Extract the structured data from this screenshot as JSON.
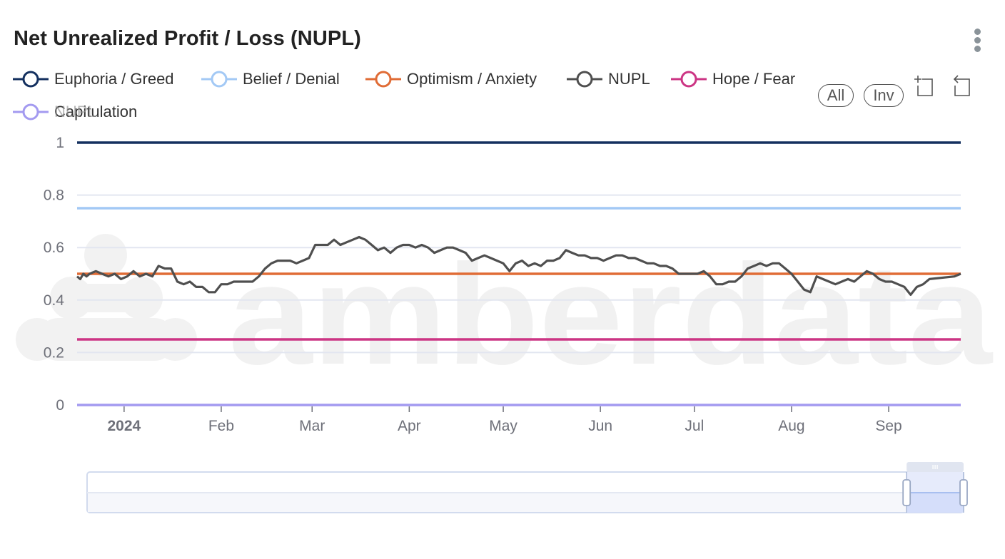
{
  "header": {
    "title": "Net Unrealized Profit / Loss (NUPL)",
    "menu_icon": "kebab-menu-icon"
  },
  "toolbar": {
    "all_label": "All",
    "inv_label": "Inv",
    "zoom_icon": "data-zoom-icon",
    "reset_icon": "zoom-reset-icon"
  },
  "watermark": "amberdata",
  "colors": {
    "euphoria": "#14305f",
    "belief": "#a3c9f5",
    "optimism": "#e06c36",
    "nupl": "#4f4f4f",
    "hope": "#cc3584",
    "capitulation": "#a39af0",
    "grid": "#e2e6f0",
    "axis_text": "#6e7079"
  },
  "legend": [
    {
      "label": "Euphoria / Greed",
      "color": "#14305f"
    },
    {
      "label": "Belief / Denial",
      "color": "#a3c9f5"
    },
    {
      "label": "Optimism / Anxiety",
      "color": "#e06c36"
    },
    {
      "label": "NUPL",
      "color": "#4f4f4f"
    },
    {
      "label": "Hope / Fear",
      "color": "#cc3584"
    },
    {
      "label": "Capitulation",
      "color": "#a39af0",
      "overlap_text": "NUPL"
    }
  ],
  "datazoom": {
    "start_fraction": 0.935,
    "end_fraction": 1.0,
    "handle_icon": "drag-handle-icon"
  },
  "chart_data": {
    "type": "line",
    "title": "Net Unrealized Profit / Loss (NUPL)",
    "xlabel": "",
    "ylabel": "",
    "ylim": [
      0,
      1
    ],
    "xlim": [
      "2023-12-17",
      "2024-09-24"
    ],
    "grid": true,
    "legend_position": "top-left",
    "y_ticks": [
      "0",
      "0.2",
      "0.4",
      "0.6",
      "0.8",
      "1"
    ],
    "x_ticks": [
      {
        "label": "2024",
        "date": "2024-01-01",
        "bold": true
      },
      {
        "label": "Feb",
        "date": "2024-02-01"
      },
      {
        "label": "Mar",
        "date": "2024-03-01"
      },
      {
        "label": "Apr",
        "date": "2024-04-01"
      },
      {
        "label": "May",
        "date": "2024-05-01"
      },
      {
        "label": "Jun",
        "date": "2024-06-01"
      },
      {
        "label": "Jul",
        "date": "2024-07-01"
      },
      {
        "label": "Aug",
        "date": "2024-08-01"
      },
      {
        "label": "Sep",
        "date": "2024-09-01"
      }
    ],
    "thresholds": [
      {
        "name": "Euphoria / Greed",
        "value": 1.0
      },
      {
        "name": "Belief / Denial",
        "value": 0.75
      },
      {
        "name": "Optimism / Anxiety",
        "value": 0.5
      },
      {
        "name": "Hope / Fear",
        "value": 0.25
      },
      {
        "name": "Capitulation",
        "value": 0.0
      }
    ],
    "series": [
      {
        "name": "NUPL",
        "x_days_from_start": [
          0,
          1,
          2,
          3,
          4,
          6,
          8,
          10,
          12,
          14,
          16,
          18,
          20,
          22,
          24,
          26,
          28,
          30,
          32,
          34,
          36,
          38,
          40,
          42,
          44,
          46,
          48,
          50,
          52,
          54,
          56,
          58,
          60,
          62,
          64,
          66,
          68,
          70,
          72,
          74,
          76,
          78,
          80,
          82,
          84,
          86,
          88,
          90,
          92,
          94,
          96,
          98,
          100,
          102,
          104,
          106,
          108,
          110,
          112,
          114,
          116,
          118,
          120,
          122,
          124,
          126,
          128,
          130,
          132,
          134,
          136,
          138,
          140,
          142,
          144,
          146,
          148,
          150,
          152,
          154,
          156,
          158,
          160,
          162,
          164,
          166,
          168,
          170,
          172,
          174,
          176,
          178,
          180,
          182,
          184,
          186,
          188,
          190,
          192,
          194,
          196,
          198,
          200,
          202,
          204,
          206,
          208,
          210,
          212,
          214,
          216,
          218,
          220,
          222,
          224,
          226,
          228,
          230,
          232,
          234,
          236,
          238,
          240,
          242,
          244,
          246,
          248,
          250,
          252,
          254,
          256,
          258,
          260,
          262,
          264,
          266,
          268,
          270,
          272,
          280,
          282
        ],
        "values": [
          0.49,
          0.48,
          0.5,
          0.49,
          0.5,
          0.51,
          0.5,
          0.49,
          0.5,
          0.48,
          0.49,
          0.51,
          0.49,
          0.5,
          0.49,
          0.53,
          0.52,
          0.52,
          0.47,
          0.46,
          0.47,
          0.45,
          0.45,
          0.43,
          0.43,
          0.46,
          0.46,
          0.47,
          0.47,
          0.47,
          0.47,
          0.49,
          0.52,
          0.54,
          0.55,
          0.55,
          0.55,
          0.54,
          0.55,
          0.56,
          0.61,
          0.61,
          0.61,
          0.63,
          0.61,
          0.62,
          0.63,
          0.64,
          0.63,
          0.61,
          0.59,
          0.6,
          0.58,
          0.6,
          0.61,
          0.61,
          0.6,
          0.61,
          0.6,
          0.58,
          0.59,
          0.6,
          0.6,
          0.59,
          0.58,
          0.55,
          0.56,
          0.57,
          0.56,
          0.55,
          0.54,
          0.51,
          0.54,
          0.55,
          0.53,
          0.54,
          0.53,
          0.55,
          0.55,
          0.56,
          0.59,
          0.58,
          0.57,
          0.57,
          0.56,
          0.56,
          0.55,
          0.56,
          0.57,
          0.57,
          0.56,
          0.56,
          0.55,
          0.54,
          0.54,
          0.53,
          0.53,
          0.52,
          0.5,
          0.5,
          0.5,
          0.5,
          0.51,
          0.49,
          0.46,
          0.46,
          0.47,
          0.47,
          0.49,
          0.52,
          0.53,
          0.54,
          0.53,
          0.54,
          0.54,
          0.52,
          0.5,
          0.47,
          0.44,
          0.43,
          0.49,
          0.48,
          0.47,
          0.46,
          0.47,
          0.48,
          0.47,
          0.49,
          0.51,
          0.5,
          0.48,
          0.47,
          0.47,
          0.46,
          0.45,
          0.42,
          0.45,
          0.46,
          0.48,
          0.49,
          0.5,
          0.5,
          0.5
        ]
      }
    ]
  }
}
